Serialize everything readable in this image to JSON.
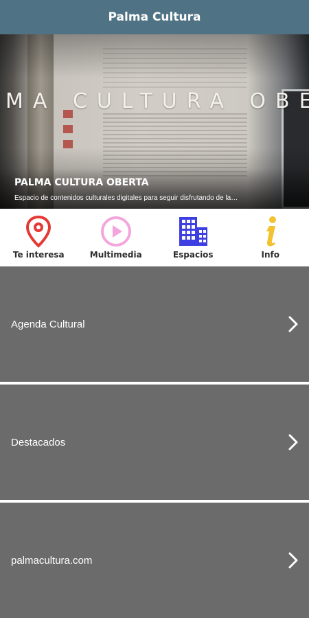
{
  "app": {
    "title": "Palma Cultura"
  },
  "hero": {
    "overlay_text": "MA CULTURA OBE",
    "title": "PALMA CULTURA OBERTA",
    "subtitle": "Espacio de contenidos culturales digitales para seguir disfrutando de la…"
  },
  "icons": {
    "items": [
      {
        "label": "Te interesa",
        "icon": "map-pin-icon",
        "color": "#e53935"
      },
      {
        "label": "Multimedia",
        "icon": "play-circle-icon",
        "color": "#f2a6dc"
      },
      {
        "label": "Espacios",
        "icon": "buildings-icon",
        "color": "#3d3fe0"
      },
      {
        "label": "Info",
        "icon": "info-icon",
        "color": "#f2c230"
      }
    ]
  },
  "menu": {
    "items": [
      {
        "label": "Agenda Cultural",
        "icon": "chevron-right-icon"
      },
      {
        "label": "Destacados",
        "icon": "chevron-right-icon"
      },
      {
        "label": "palmacultura.com",
        "icon": "chevron-right-icon"
      }
    ]
  },
  "colors": {
    "topbar": "#4f7384",
    "menu_row": "#6b6b6b",
    "divider": "#ffffff"
  }
}
